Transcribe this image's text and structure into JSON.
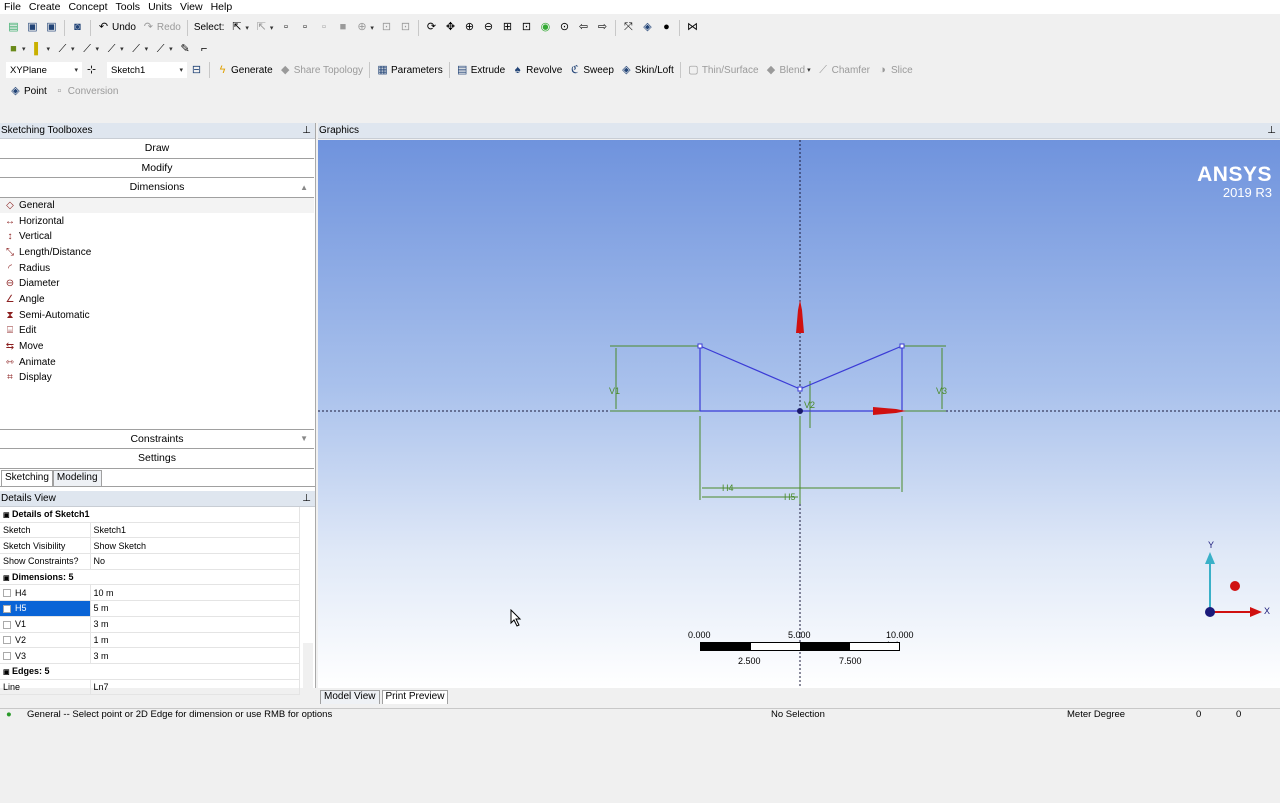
{
  "menu": [
    "File",
    "Create",
    "Concept",
    "Tools",
    "Units",
    "View",
    "Help"
  ],
  "toolbar1": {
    "undo": "Undo",
    "redo": "Redo",
    "select": "Select:"
  },
  "toolbar3": {
    "plane": "XYPlane",
    "sketch": "Sketch1",
    "generate": "Generate",
    "share_topology": "Share Topology",
    "parameters": "Parameters",
    "extrude": "Extrude",
    "revolve": "Revolve",
    "sweep": "Sweep",
    "skin_loft": "Skin/Loft",
    "thin_surface": "Thin/Surface",
    "blend": "Blend",
    "chamfer": "Chamfer",
    "slice": "Slice"
  },
  "toolbar4": {
    "point": "Point",
    "conversion": "Conversion"
  },
  "toolbox": {
    "title": "Sketching Toolboxes",
    "groups": {
      "draw": "Draw",
      "modify": "Modify",
      "dimensions": "Dimensions",
      "constraints": "Constraints",
      "settings": "Settings"
    },
    "dimension_items": [
      "General",
      "Horizontal",
      "Vertical",
      "Length/Distance",
      "Radius",
      "Diameter",
      "Angle",
      "Semi-Automatic",
      "Edit",
      "Move",
      "Animate",
      "Display"
    ],
    "tabs": {
      "sketching": "Sketching",
      "modeling": "Modeling"
    }
  },
  "details": {
    "title": "Details View",
    "section1": "Details of Sketch1",
    "rows1": [
      {
        "k": "Sketch",
        "v": "Sketch1"
      },
      {
        "k": "Sketch Visibility",
        "v": "Show Sketch"
      },
      {
        "k": "Show Constraints?",
        "v": "No"
      }
    ],
    "section2": "Dimensions: 5",
    "dims": [
      {
        "k": "H4",
        "v": "10 m"
      },
      {
        "k": "H5",
        "v": "5 m"
      },
      {
        "k": "V1",
        "v": "3 m"
      },
      {
        "k": "V2",
        "v": "1 m"
      },
      {
        "k": "V3",
        "v": "3 m"
      }
    ],
    "section3": "Edges: 5",
    "rows3": [
      {
        "k": "Line",
        "v": "Ln7"
      }
    ]
  },
  "graphics": {
    "title": "Graphics",
    "logo_brand": "ANSYS",
    "logo_version": "2019 R3",
    "dim_labels": {
      "v1": "V1",
      "v2": "V2",
      "v3": "V3",
      "h4": "H4",
      "h5": "H5"
    },
    "scale": {
      "t0": "0.000",
      "t1": "5.000",
      "t2": "10.000 (m)",
      "t3": "2.500",
      "t4": "7.500"
    },
    "triad": {
      "x": "X",
      "y": "Y"
    }
  },
  "bottom_tabs": {
    "model_view": "Model View",
    "print_preview": "Print Preview"
  },
  "status": {
    "message": "General -- Select point or 2D Edge for dimension or use RMB for options",
    "selection": "No Selection",
    "units": "Meter  Degree",
    "c1": "0",
    "c2": "0"
  },
  "colors": {
    "sketch": "#3b3bd6",
    "dimension": "#4a8a2a",
    "axis_red": "#d01010",
    "bg_top": "#6f93dd",
    "highlight": "#0a64d6"
  }
}
